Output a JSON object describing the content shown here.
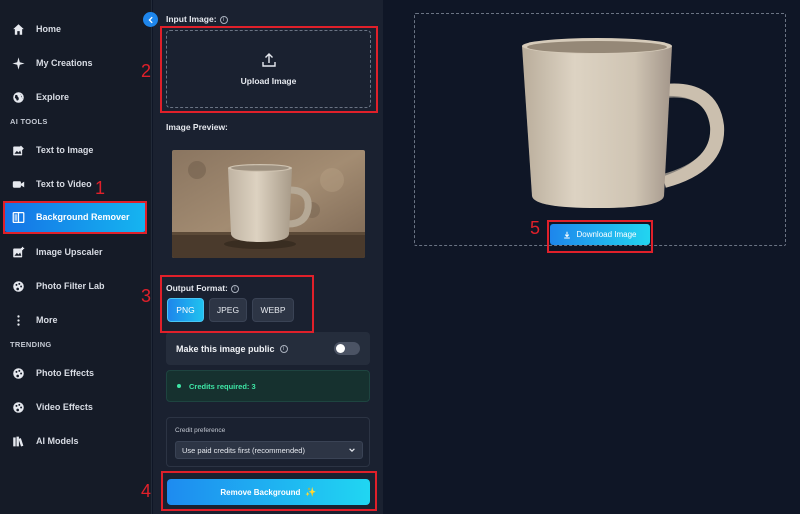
{
  "sidebar": {
    "items": [
      {
        "label": "Home",
        "icon": "home-icon"
      },
      {
        "label": "My Creations",
        "icon": "sparkle-icon"
      },
      {
        "label": "Explore",
        "icon": "globe-icon"
      },
      {
        "label": "Text to Image",
        "icon": "image-edit-icon"
      },
      {
        "label": "Text to Video",
        "icon": "video-icon"
      },
      {
        "label": "Background Remover",
        "icon": "split-square-icon",
        "active": true
      },
      {
        "label": "Image Upscaler",
        "icon": "image-plus-icon"
      },
      {
        "label": "Photo Filter Lab",
        "icon": "palette-icon"
      },
      {
        "label": "More",
        "icon": "more-vertical-icon"
      },
      {
        "label": "Photo Effects",
        "icon": "palette-icon"
      },
      {
        "label": "Video Effects",
        "icon": "palette-icon"
      },
      {
        "label": "AI Models",
        "icon": "books-icon"
      }
    ],
    "sections": {
      "ai_tools": "AI TOOLS",
      "trending": "TRENDING"
    }
  },
  "panel": {
    "input_label": "Input Image:",
    "upload_label": "Upload Image",
    "preview_label": "Image Preview:",
    "output_label": "Output Format:",
    "formats": [
      "PNG",
      "JPEG",
      "WEBP"
    ],
    "selected_format": "PNG",
    "public_label": "Make this image public",
    "public_enabled": false,
    "credits_text": "Credits required: 3",
    "pref_label": "Credit preference",
    "pref_value": "Use paid credits first (recommended)",
    "remove_label": "Remove Background"
  },
  "result": {
    "download_label": "Download Image"
  },
  "annotations": [
    "1",
    "2",
    "3",
    "4",
    "5"
  ],
  "colors": {
    "accent": "#1e86ec",
    "accent_cyan": "#22d5f0",
    "annotation_red": "#e0202a",
    "credits_green": "#3ee6a6"
  }
}
